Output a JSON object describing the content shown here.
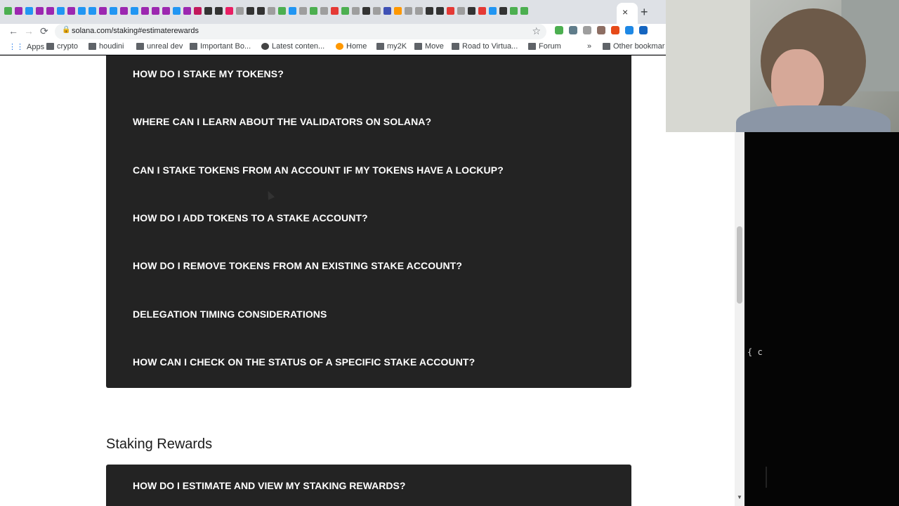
{
  "browser": {
    "url": "solana.com/staking#estimaterewards",
    "new_tab_label": "+",
    "close_tab_label": "×",
    "back_label": "←",
    "forward_label": "→",
    "reload_label": "⟳",
    "star_label": "☆",
    "lock_label": "🔒",
    "tab_icon_colors": [
      "#4caf50",
      "#9c27b0",
      "#2196f3",
      "#9c27b0",
      "#9c27b0",
      "#2196f3",
      "#9c27b0",
      "#2196f3",
      "#2196f3",
      "#9c27b0",
      "#2196f3",
      "#9c27b0",
      "#2196f3",
      "#9c27b0",
      "#9c27b0",
      "#9c27b0",
      "#2196f3",
      "#9c27b0",
      "#c2185b",
      "#333333",
      "#333333",
      "#e91e63",
      "#9e9e9e",
      "#333333",
      "#333333",
      "#9e9e9e",
      "#4caf50",
      "#2196f3",
      "#9e9e9e",
      "#4caf50",
      "#9e9e9e",
      "#e53935",
      "#4caf50",
      "#9e9e9e",
      "#333333",
      "#9e9e9e",
      "#3f51b5",
      "#ff9800",
      "#9e9e9e",
      "#9e9e9e",
      "#333333",
      "#333333",
      "#e53935",
      "#9e9e9e",
      "#333333",
      "#e53935",
      "#2196f3",
      "#333333",
      "#4caf50",
      "#4caf50"
    ],
    "extension_colors": [
      "#4caf50",
      "#607d8b",
      "#9e9e9e",
      "#8d6e63",
      "#e64a19",
      "#1e88e5",
      "#1565c0"
    ]
  },
  "bookmarks": [
    {
      "label": "Apps",
      "icon": "apps-grid-icon"
    },
    {
      "label": "crypto",
      "icon": "folder-icon"
    },
    {
      "label": "houdini",
      "icon": "folder-icon"
    },
    {
      "label": "unreal dev",
      "icon": "folder-icon"
    },
    {
      "label": "Important Bo...",
      "icon": "folder-icon"
    },
    {
      "label": "Latest conten...",
      "icon": "globe-icon"
    },
    {
      "label": "Home",
      "icon": "heart-icon"
    },
    {
      "label": "my2K",
      "icon": "logo-icon"
    },
    {
      "label": "Move",
      "icon": "page-icon"
    },
    {
      "label": "Road to Virtua...",
      "icon": "logo-icon"
    },
    {
      "label": "Forum",
      "icon": "logo-icon"
    },
    {
      "label": "»",
      "icon": ""
    },
    {
      "label": "Other bookmar",
      "icon": "folder-icon"
    }
  ],
  "faq": {
    "items": [
      "HOW DO I STAKE MY TOKENS?",
      "WHERE CAN I LEARN ABOUT THE VALIDATORS ON SOLANA?",
      "CAN I STAKE TOKENS FROM AN ACCOUNT IF MY TOKENS HAVE A LOCKUP?",
      "HOW DO I ADD TOKENS TO A STAKE ACCOUNT?",
      "HOW DO I REMOVE TOKENS FROM AN EXISTING STAKE ACCOUNT?",
      "DELEGATION TIMING CONSIDERATIONS",
      "HOW CAN I CHECK ON THE STATUS OF A SPECIFIC STAKE ACCOUNT?"
    ]
  },
  "staking_rewards": {
    "title": "Staking Rewards",
    "items": [
      "HOW DO I ESTIMATE AND VIEW MY STAKING REWARDS?"
    ]
  },
  "terminal": {
    "text": "{ c"
  }
}
